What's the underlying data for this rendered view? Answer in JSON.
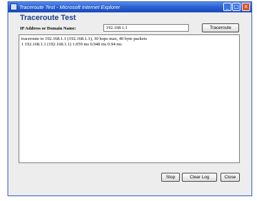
{
  "window": {
    "title": "Traceroute Test - Microsoft Internet Explorer",
    "controls": {
      "minimize": "_",
      "maximize": "□",
      "close": "×"
    }
  },
  "page": {
    "title": "Traceroute Test"
  },
  "form": {
    "ip_label": "IP Address or Domain Name:",
    "ip_value": "192.168.1.1",
    "traceroute_button": "Traceroute"
  },
  "log": {
    "lines": [
      "traceroute to 192.168.1.1 (192.168.1.1), 30 hops max, 40 byte packets",
      "1 192.168.1.1 (192.168.1.1) 1.059 ms 0.948 ms 0.94 ms"
    ]
  },
  "buttons": {
    "stop": "Stop",
    "clear_log": "Clear Log",
    "close": "Close"
  },
  "colors": {
    "title_bar": "#2b62d6",
    "page_title": "#1a3f8c"
  }
}
